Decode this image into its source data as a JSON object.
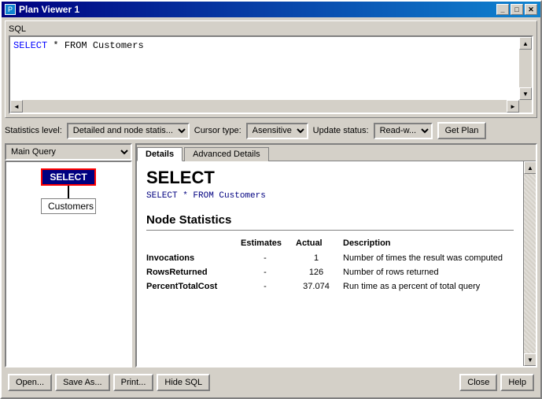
{
  "window": {
    "title": "Plan Viewer 1",
    "title_icon": "P",
    "controls": {
      "minimize": "_",
      "maximize": "□",
      "close": "✕"
    }
  },
  "sql_section": {
    "label": "SQL",
    "content": "SELECT * FROM Customers",
    "keyword": "SELECT",
    "rest": " * FROM Customers"
  },
  "stats_bar": {
    "stats_label": "Statistics level:",
    "stats_value": "Detailed and node statis...",
    "cursor_label": "Cursor type:",
    "cursor_value": "Asensitive",
    "update_label": "Update status:",
    "update_value": "Read-w...",
    "get_plan_label": "Get Plan"
  },
  "tree": {
    "dropdown_value": "Main Query",
    "select_node": "SELECT",
    "table_node": "Customers"
  },
  "tabs": {
    "details_label": "Details",
    "advanced_label": "Advanced Details"
  },
  "details": {
    "title": "SELECT",
    "query": "SELECT * FROM Customers",
    "node_stats_title": "Node Statistics",
    "columns": {
      "estimates": "Estimates",
      "actual": "Actual",
      "description": "Description"
    },
    "rows": [
      {
        "name": "Invocations",
        "estimates": "-",
        "actual": "1",
        "description": "Number of times the result was computed"
      },
      {
        "name": "RowsReturned",
        "estimates": "-",
        "actual": "126",
        "description": "Number of rows returned"
      },
      {
        "name": "PercentTotalCost",
        "estimates": "-",
        "actual": "37.074",
        "description": "Run time as a percent of total query"
      }
    ]
  },
  "bottom_toolbar": {
    "open_label": "Open...",
    "save_as_label": "Save As...",
    "print_label": "Print...",
    "hide_sql_label": "Hide SQL",
    "close_label": "Close",
    "help_label": "Help"
  }
}
